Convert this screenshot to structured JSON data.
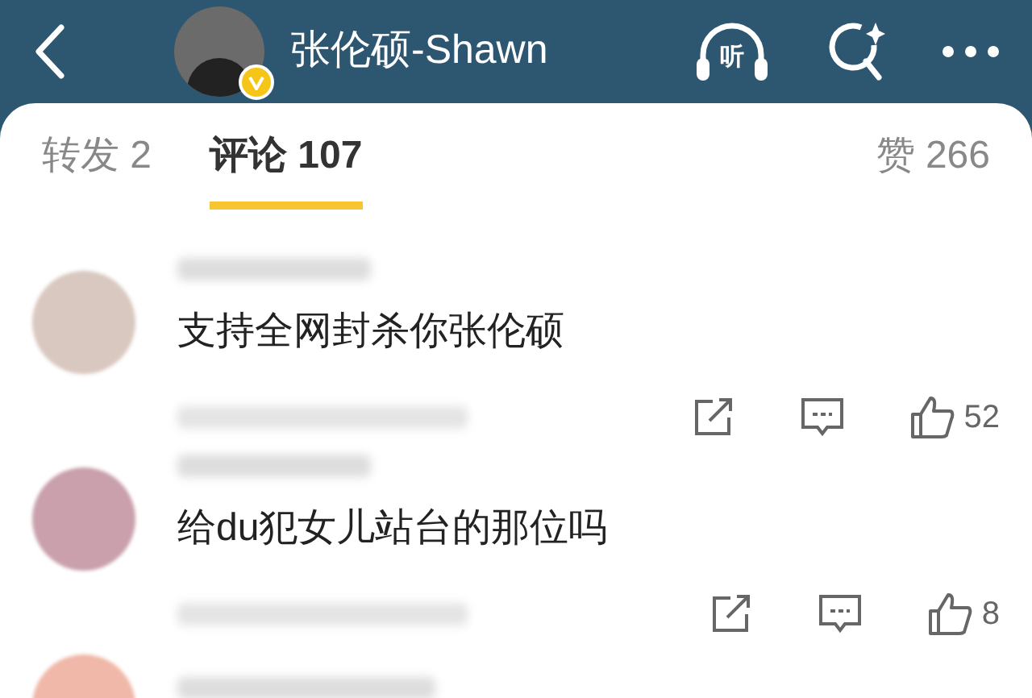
{
  "header": {
    "title": "张伦硕-Shawn",
    "verified": true,
    "listen_label": "听"
  },
  "tabs": [
    {
      "label": "转发 2",
      "selected": false
    },
    {
      "label": "评论 107",
      "selected": true
    },
    {
      "label": "赞 266",
      "selected": false
    }
  ],
  "comments": [
    {
      "text": "支持全网封杀你张伦硕",
      "likes": "52"
    },
    {
      "text": "给du犯女儿站台的那位吗",
      "likes": "8"
    }
  ]
}
